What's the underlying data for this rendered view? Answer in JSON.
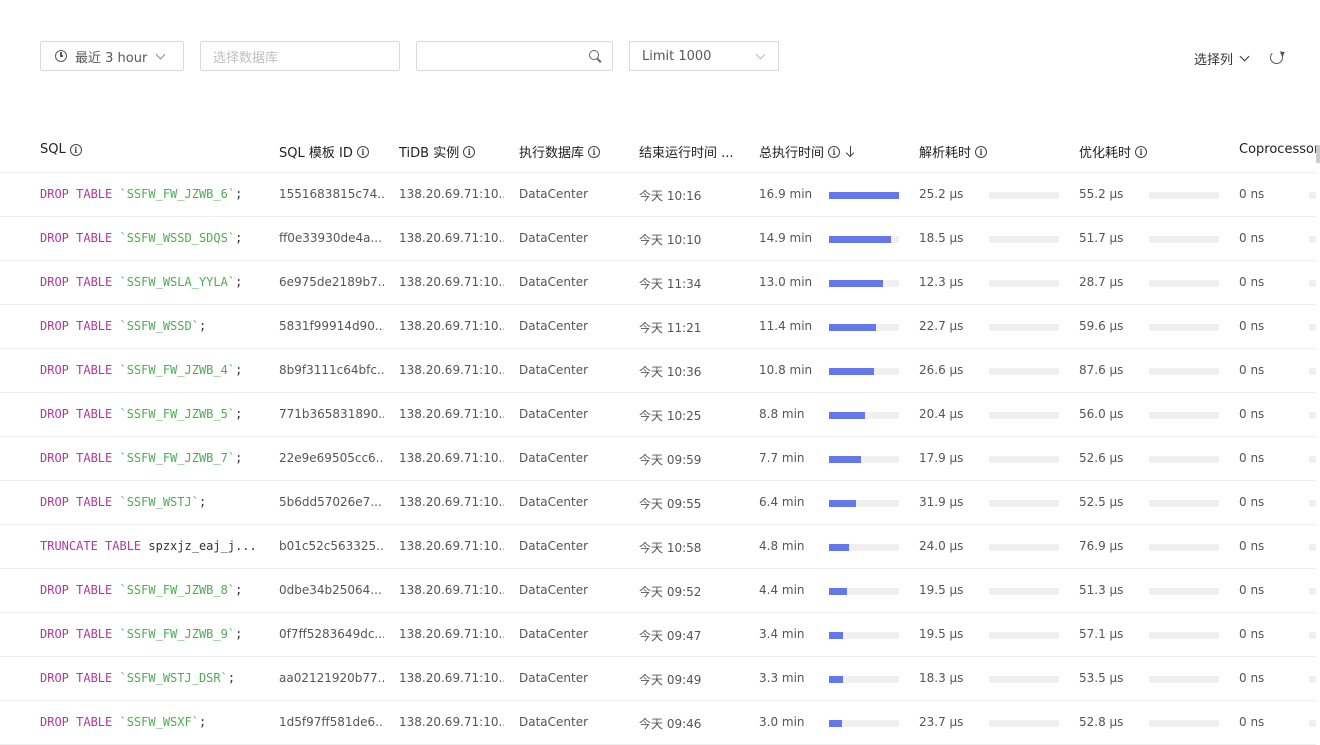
{
  "toolbar": {
    "time_range": "最近 3 hour",
    "database_placeholder": "选择数据库",
    "search_value": "",
    "limit": "Limit 1000",
    "select_columns": "选择列"
  },
  "columns": [
    "SQL",
    "SQL 模板 ID",
    "TiDB 实例",
    "执行数据库",
    "结束运行时间 ...",
    "总执行时间",
    "解析耗时",
    "优化耗时",
    "Coprocessor"
  ],
  "rows": [
    {
      "kw": "DROP TABLE ",
      "name": "`SSFW_FW_JZWB_6`",
      "end": ";",
      "digest": "1551683815c74...",
      "instance": "138.20.69.71:10...",
      "db": "DataCenter",
      "time": "今天 10:16",
      "total": "16.9 min",
      "total_ratio": 1.0,
      "parse": "25.2 μs",
      "opt": "55.2 μs",
      "cop": "0 ns"
    },
    {
      "kw": "DROP TABLE ",
      "name": "`SSFW_WSSD_SDQS`",
      "end": ";",
      "digest": "ff0e33930de4a...",
      "instance": "138.20.69.71:10...",
      "db": "DataCenter",
      "time": "今天 10:10",
      "total": "14.9 min",
      "total_ratio": 0.88,
      "parse": "18.5 μs",
      "opt": "51.7 μs",
      "cop": "0 ns"
    },
    {
      "kw": "DROP TABLE ",
      "name": "`SSFW_WSLA_YYLA`",
      "end": ";",
      "digest": "6e975de2189b7...",
      "instance": "138.20.69.71:10...",
      "db": "DataCenter",
      "time": "今天 11:34",
      "total": "13.0 min",
      "total_ratio": 0.77,
      "parse": "12.3 μs",
      "opt": "28.7 μs",
      "cop": "0 ns"
    },
    {
      "kw": "DROP TABLE ",
      "name": "`SSFW_WSSD`",
      "end": ";",
      "digest": "5831f99914d90...",
      "instance": "138.20.69.71:10...",
      "db": "DataCenter",
      "time": "今天 11:21",
      "total": "11.4 min",
      "total_ratio": 0.67,
      "parse": "22.7 μs",
      "opt": "59.6 μs",
      "cop": "0 ns"
    },
    {
      "kw": "DROP TABLE ",
      "name": "`SSFW_FW_JZWB_4`",
      "end": ";",
      "digest": "8b9f3111c64bfc...",
      "instance": "138.20.69.71:10...",
      "db": "DataCenter",
      "time": "今天 10:36",
      "total": "10.8 min",
      "total_ratio": 0.64,
      "parse": "26.6 μs",
      "opt": "87.6 μs",
      "cop": "0 ns"
    },
    {
      "kw": "DROP TABLE ",
      "name": "`SSFW_FW_JZWB_5`",
      "end": ";",
      "digest": "771b365831890...",
      "instance": "138.20.69.71:10...",
      "db": "DataCenter",
      "time": "今天 10:25",
      "total": "8.8 min",
      "total_ratio": 0.52,
      "parse": "20.4 μs",
      "opt": "56.0 μs",
      "cop": "0 ns"
    },
    {
      "kw": "DROP TABLE ",
      "name": "`SSFW_FW_JZWB_7`",
      "end": ";",
      "digest": "22e9e69505cc6...",
      "instance": "138.20.69.71:10...",
      "db": "DataCenter",
      "time": "今天 09:59",
      "total": "7.7 min",
      "total_ratio": 0.46,
      "parse": "17.9 μs",
      "opt": "52.6 μs",
      "cop": "0 ns"
    },
    {
      "kw": "DROP TABLE ",
      "name": "`SSFW_WSTJ`",
      "end": ";",
      "digest": "5b6dd57026e7...",
      "instance": "138.20.69.71:10...",
      "db": "DataCenter",
      "time": "今天 09:55",
      "total": "6.4 min",
      "total_ratio": 0.38,
      "parse": "31.9 μs",
      "opt": "52.5 μs",
      "cop": "0 ns"
    },
    {
      "kw": "TRUNCATE TABLE ",
      "name": "spzxjz_eaj_j...",
      "end": "",
      "digest": "b01c52c563325...",
      "instance": "138.20.69.71:10...",
      "db": "DataCenter",
      "time": "今天 10:58",
      "total": "4.8 min",
      "total_ratio": 0.28,
      "parse": "24.0 μs",
      "opt": "76.9 μs",
      "cop": "0 ns",
      "plain": true
    },
    {
      "kw": "DROP TABLE ",
      "name": "`SSFW_FW_JZWB_8`",
      "end": ";",
      "digest": "0dbe34b25064...",
      "instance": "138.20.69.71:10...",
      "db": "DataCenter",
      "time": "今天 09:52",
      "total": "4.4 min",
      "total_ratio": 0.26,
      "parse": "19.5 μs",
      "opt": "51.3 μs",
      "cop": "0 ns"
    },
    {
      "kw": "DROP TABLE ",
      "name": "`SSFW_FW_JZWB_9`",
      "end": ";",
      "digest": "0f7ff5283649dc...",
      "instance": "138.20.69.71:10...",
      "db": "DataCenter",
      "time": "今天 09:47",
      "total": "3.4 min",
      "total_ratio": 0.2,
      "parse": "19.5 μs",
      "opt": "57.1 μs",
      "cop": "0 ns"
    },
    {
      "kw": "DROP TABLE ",
      "name": "`SSFW_WSTJ_DSR`",
      "end": ";",
      "digest": "aa02121920b77...",
      "instance": "138.20.69.71:10...",
      "db": "DataCenter",
      "time": "今天 09:49",
      "total": "3.3 min",
      "total_ratio": 0.2,
      "parse": "18.3 μs",
      "opt": "53.5 μs",
      "cop": "0 ns"
    },
    {
      "kw": "DROP TABLE ",
      "name": "`SSFW_WSXF`",
      "end": ";",
      "digest": "1d5f97ff581de6...",
      "instance": "138.20.69.71:10...",
      "db": "DataCenter",
      "time": "今天 09:46",
      "total": "3.0 min",
      "total_ratio": 0.18,
      "parse": "23.7 μs",
      "opt": "52.8 μs",
      "cop": "0 ns"
    }
  ],
  "colors": {
    "keyword": "#b0399f",
    "string": "#4caf50",
    "bar": "#6578eb"
  }
}
